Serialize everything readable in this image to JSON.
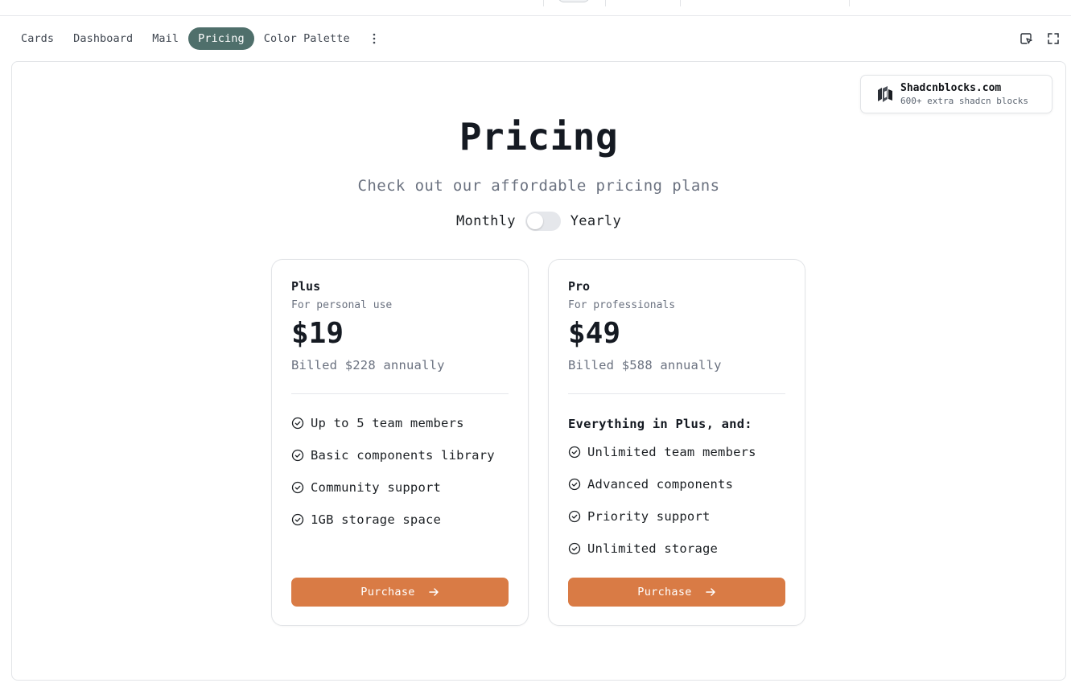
{
  "tabs": [
    {
      "label": "Cards"
    },
    {
      "label": "Dashboard"
    },
    {
      "label": "Mail"
    },
    {
      "label": "Pricing",
      "active": true
    },
    {
      "label": "Color Palette"
    }
  ],
  "promo": {
    "title": "Shadcnblocks.com",
    "subtitle": "600+ extra shadcn blocks"
  },
  "hero": {
    "title": "Pricing",
    "subtitle": "Check out our affordable pricing plans"
  },
  "billing": {
    "monthly": "Monthly",
    "yearly": "Yearly",
    "yearly_selected": false
  },
  "plans": [
    {
      "name": "Plus",
      "description": "For personal use",
      "price": "$19",
      "billed": "Billed $228 annually",
      "features_heading": "",
      "features": [
        "Up to 5 team members",
        "Basic components library",
        "Community support",
        "1GB storage space"
      ],
      "button": "Purchase"
    },
    {
      "name": "Pro",
      "description": "For professionals",
      "price": "$49",
      "billed": "Billed $588 annually",
      "features_heading": "Everything in Plus, and:",
      "features": [
        "Unlimited team members",
        "Advanced components",
        "Priority support",
        "Unlimited storage"
      ],
      "button": "Purchase"
    }
  ],
  "colors": {
    "accent": "#d97b45",
    "active_tab": "#4f6f6b"
  },
  "icons": {
    "more": "more-vertical-icon",
    "inspect": "cursor-select-icon",
    "fullscreen": "fullscreen-icon",
    "check": "check-circle-icon",
    "arrow": "arrow-right-icon",
    "logo": "shadcnblocks-logo"
  }
}
